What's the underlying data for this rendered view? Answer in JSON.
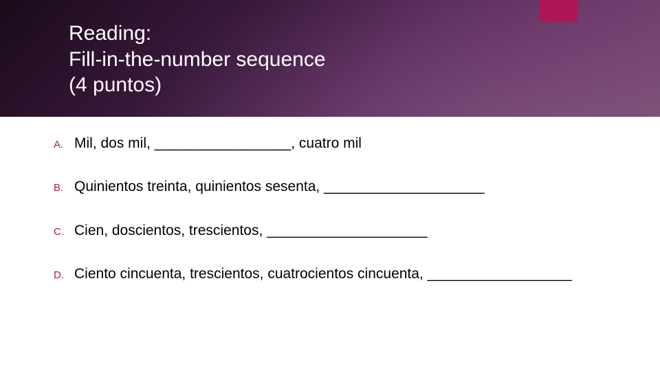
{
  "accent_color": "#b01657",
  "title": {
    "line1": "Reading:",
    "line2": "Fill-in-the-number sequence",
    "line3": "(4 puntos)"
  },
  "questions": [
    {
      "marker": "A.",
      "text": "Mil, dos mil, _________________, cuatro mil"
    },
    {
      "marker": "B.",
      "text": "Quinientos treinta, quinientos sesenta, ____________________"
    },
    {
      "marker": "C.",
      "text": "Cien, doscientos, trescientos, ____________________"
    },
    {
      "marker": "D.",
      "text": "Ciento cincuenta, trescientos, cuatrocientos cincuenta, __________________"
    }
  ]
}
